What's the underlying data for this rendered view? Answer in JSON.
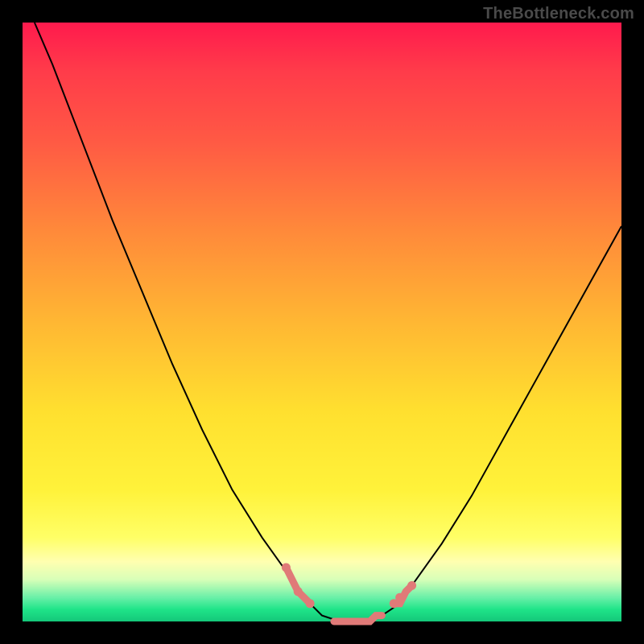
{
  "watermark": "TheBottleneck.com",
  "chart_data": {
    "type": "line",
    "title": "",
    "xlabel": "",
    "ylabel": "",
    "xlim": [
      0,
      100
    ],
    "ylim": [
      0,
      100
    ],
    "grid": false,
    "legend": false,
    "series": [
      {
        "name": "bottleneck-curve",
        "color": "#000000",
        "x": [
          2,
          5,
          10,
          15,
          20,
          25,
          30,
          35,
          40,
          45,
          48,
          50,
          53,
          55,
          58,
          60,
          63,
          65,
          70,
          75,
          80,
          85,
          90,
          95,
          100
        ],
        "y": [
          100,
          93,
          80,
          67,
          55,
          43,
          32,
          22,
          14,
          7,
          3,
          1,
          0,
          0,
          0,
          1,
          3,
          6,
          13,
          21,
          30,
          39,
          48,
          57,
          66
        ]
      }
    ],
    "highlight": {
      "name": "near-zero-band",
      "color": "#e07a78",
      "segments": [
        {
          "x": [
            44,
            45,
            46,
            47,
            48
          ],
          "y": [
            9,
            7,
            5,
            4,
            3
          ]
        },
        {
          "x": [
            52,
            53,
            54,
            55,
            56,
            57,
            58,
            59,
            60
          ],
          "y": [
            0,
            0,
            0,
            0,
            0,
            0,
            0,
            1,
            1
          ]
        },
        {
          "x": [
            62,
            63,
            64,
            65
          ],
          "y": [
            3,
            3,
            5,
            6
          ]
        }
      ],
      "points": [
        {
          "x": 44,
          "y": 9
        },
        {
          "x": 46,
          "y": 5
        },
        {
          "x": 48,
          "y": 3
        },
        {
          "x": 62,
          "y": 3
        },
        {
          "x": 63,
          "y": 4
        },
        {
          "x": 65,
          "y": 6
        }
      ]
    },
    "background_gradient": {
      "top": "#ff1a4d",
      "upper_mid": "#ff8a3a",
      "mid": "#ffe02f",
      "lower_mid": "#ffffb0",
      "bottom": "#14c77a"
    }
  }
}
